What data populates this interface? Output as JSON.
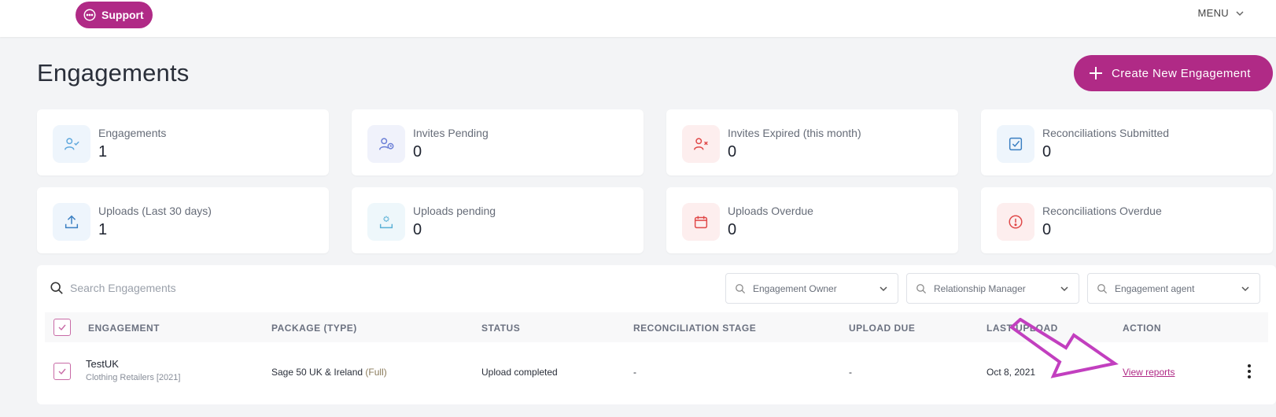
{
  "header": {
    "support_label": "Support",
    "menu_label": "MENU"
  },
  "page": {
    "title": "Engagements",
    "create_label": "Create New Engagement"
  },
  "stats": [
    {
      "label": "Engagements",
      "value": "1",
      "icon": "user-check-icon",
      "color": "#5fa8dd"
    },
    {
      "label": "Invites Pending",
      "value": "0",
      "icon": "user-clock-icon",
      "color": "#6b7fd6"
    },
    {
      "label": "Invites Expired (this month)",
      "value": "0",
      "icon": "user-x-icon",
      "color": "#e04848"
    },
    {
      "label": "Reconciliations Submitted",
      "value": "0",
      "icon": "check-square-icon",
      "color": "#3a7fc2"
    },
    {
      "label": "Uploads (Last 30 days)",
      "value": "1",
      "icon": "upload-icon",
      "color": "#3a7fc2"
    },
    {
      "label": "Uploads pending",
      "value": "0",
      "icon": "upload-pending-icon",
      "color": "#5ab0d6"
    },
    {
      "label": "Uploads Overdue",
      "value": "0",
      "icon": "calendar-icon",
      "color": "#e04848"
    },
    {
      "label": "Reconciliations Overdue",
      "value": "0",
      "icon": "alert-circle-icon",
      "color": "#e04848"
    }
  ],
  "search": {
    "placeholder": "Search Engagements"
  },
  "filters": [
    {
      "label": "Engagement Owner"
    },
    {
      "label": "Relationship Manager"
    },
    {
      "label": "Engagement agent"
    }
  ],
  "table": {
    "headers": [
      "ENGAGEMENT",
      "PACKAGE (TYPE)",
      "STATUS",
      "RECONCILIATION STAGE",
      "UPLOAD DUE",
      "LAST UPLOAD",
      "ACTION"
    ],
    "rows": [
      {
        "name": "TestUK",
        "sub": "Clothing Retailers [2021]",
        "package": "Sage 50 UK & Ireland",
        "package_type": "(Full)",
        "status": "Upload completed",
        "stage": "-",
        "upload_due": "-",
        "last_upload": "Oct 8, 2021",
        "action": "View reports"
      }
    ]
  },
  "colors": {
    "accent": "#b02a86",
    "arrow": "#c23fbf"
  }
}
